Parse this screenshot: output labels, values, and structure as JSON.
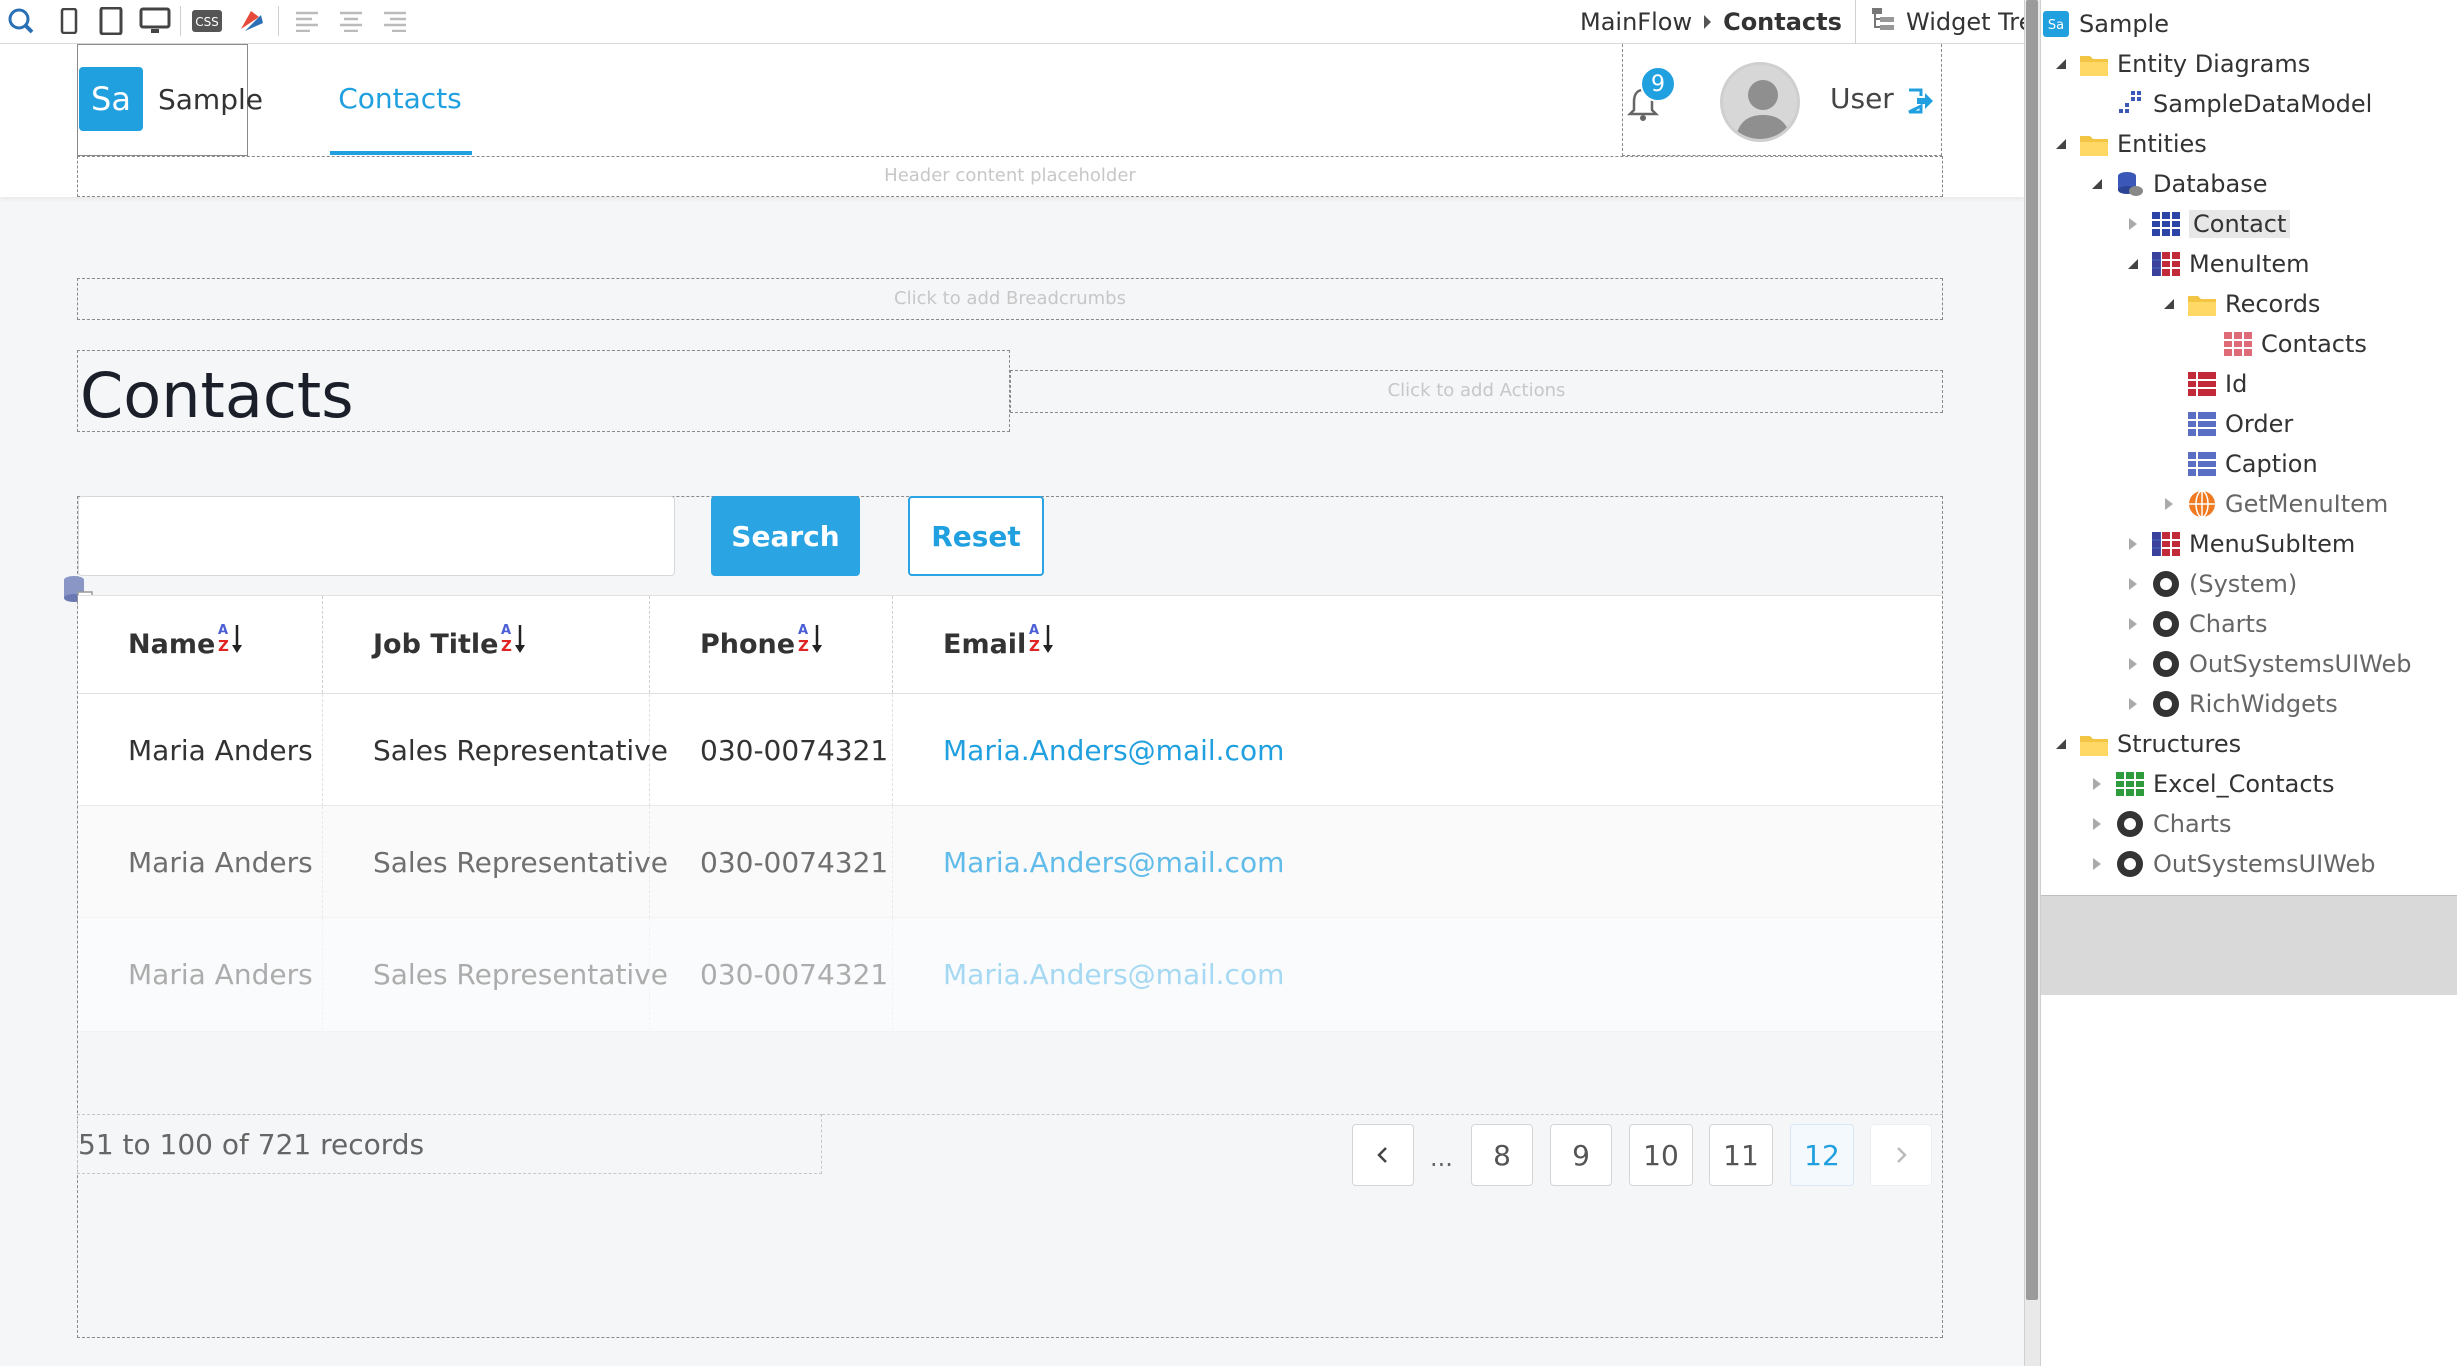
{
  "toolbar": {
    "icons": [
      "web-preview-icon",
      "mobile-icon",
      "tablet-icon",
      "desktop-icon",
      "css-icon",
      "theme-icon",
      "align-left-icon",
      "align-center-icon",
      "align-right-icon"
    ],
    "flow": "MainFlow",
    "screen": "Contacts",
    "widget_tree": "Widget Tree"
  },
  "header": {
    "logo_text": "Sa",
    "app_name": "Sample",
    "nav_tab": "Contacts",
    "notifications": "9",
    "user_name": "User",
    "content_placeholder": "Header content placeholder"
  },
  "page": {
    "breadcrumbs_placeholder": "Click to add Breadcrumbs",
    "title": "Contacts",
    "actions_placeholder": "Click to add Actions",
    "search_value": "",
    "search_button": "Search",
    "reset_button": "Reset"
  },
  "table": {
    "columns": [
      "Name",
      "Job Title",
      "Phone",
      "Email"
    ],
    "rows": [
      {
        "name": "Maria Anders",
        "job": "Sales Representative",
        "phone": "030-0074321",
        "email": "Maria.Anders@mail.com"
      },
      {
        "name": "Maria Anders",
        "job": "Sales Representative",
        "phone": "030-0074321",
        "email": "Maria.Anders@mail.com"
      },
      {
        "name": "Maria Anders",
        "job": "Sales Representative",
        "phone": "030-0074321",
        "email": "Maria.Anders@mail.com"
      }
    ],
    "records_text": "51 to 100 of 721 records",
    "pages": [
      "8",
      "9",
      "10",
      "11",
      "12"
    ],
    "ellipsis": "...",
    "active_page": "12"
  },
  "tree": {
    "root": "Sample",
    "items": [
      {
        "label": "Entity Diagrams",
        "icon": "folder-icon"
      },
      {
        "label": "SampleDataModel",
        "icon": "diagram-icon"
      },
      {
        "label": "Entities",
        "icon": "folder-icon"
      },
      {
        "label": "Database",
        "icon": "database-icon"
      },
      {
        "label": "Contact",
        "icon": "entity-icon"
      },
      {
        "label": "MenuItem",
        "icon": "entity-icon"
      },
      {
        "label": "Records",
        "icon": "folder-icon"
      },
      {
        "label": "Contacts",
        "icon": "record-icon"
      },
      {
        "label": "Id",
        "icon": "attribute-icon"
      },
      {
        "label": "Order",
        "icon": "attribute-icon"
      },
      {
        "label": "Caption",
        "icon": "attribute-icon"
      },
      {
        "label": "GetMenuItem",
        "icon": "action-icon"
      },
      {
        "label": "MenuSubItem",
        "icon": "entity-icon"
      },
      {
        "label": "(System)",
        "icon": "module-icon"
      },
      {
        "label": "Charts",
        "icon": "module-icon"
      },
      {
        "label": "OutSystemsUIWeb",
        "icon": "module-icon"
      },
      {
        "label": "RichWidgets",
        "icon": "module-icon"
      },
      {
        "label": "Structures",
        "icon": "folder-icon"
      },
      {
        "label": "Excel_Contacts",
        "icon": "structure-icon"
      },
      {
        "label": "Charts",
        "icon": "module-icon"
      },
      {
        "label": "OutSystemsUIWeb",
        "icon": "module-icon"
      }
    ]
  },
  "colors": {
    "accent": "#21a0e0",
    "canvas_bg": "#f4f6f8",
    "text": "#333333"
  }
}
